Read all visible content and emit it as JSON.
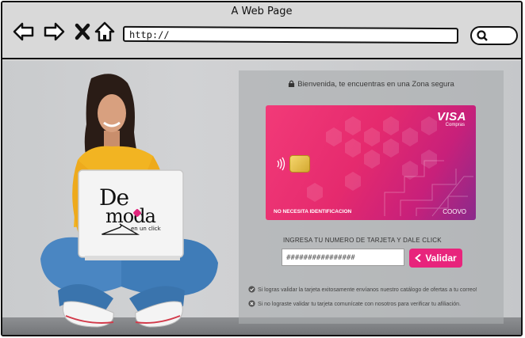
{
  "window": {
    "title": "A Web Page"
  },
  "toolbar": {
    "back_icon": "back-arrow-icon",
    "forward_icon": "forward-arrow-icon",
    "close_icon": "close-icon",
    "home_icon": "home-icon",
    "url": "http://",
    "search_icon": "search-icon"
  },
  "brand": {
    "logo_line1": "De",
    "logo_line2": "moda",
    "logo_tagline": "en un click"
  },
  "secure_banner": {
    "text": "Bienvenida, te encuentras en una Zona segura",
    "icon": "lock-icon"
  },
  "card": {
    "network": "VISA",
    "network_sub": "Compras",
    "note": "NO NECESITA IDENTIFICACION",
    "brand": "COOVO",
    "colors": {
      "start": "#f23a78",
      "end": "#8a2a8c"
    }
  },
  "form": {
    "label": "INGRESA TU NUMERO DE TARJETA Y DALE CLICK",
    "card_number_value": "################",
    "button_label": "Validar",
    "button_color": "#e8247c"
  },
  "notes": [
    {
      "icon": "check-circle-icon",
      "text": "Si logras validar la tarjeta exitosamente envíanos nuestro catálogo de ofertas a tu correo!"
    },
    {
      "icon": "x-circle-icon",
      "text": "Si no lograste validar tu tarjeta comunícate con nosotros para verificar tu afiliación."
    }
  ]
}
